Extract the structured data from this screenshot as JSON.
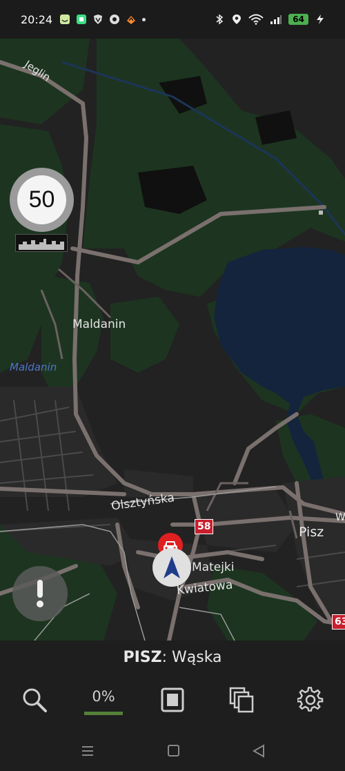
{
  "status_bar": {
    "time": "20:24",
    "battery": "64",
    "icons_left": [
      "face-app-icon",
      "android-app-icon",
      "vpn-shield-icon",
      "chrome-icon",
      "map-app-icon",
      "more-dot-icon"
    ],
    "icons_right": [
      "bluetooth-icon",
      "location-icon",
      "wifi-icon",
      "signal-icon",
      "battery-icon",
      "charging-icon"
    ]
  },
  "map": {
    "labels": {
      "jeglin": "Jeglin",
      "maldanin_town": "Maldanin",
      "maldanin_water": "Maldanin",
      "olsztynska": "Olsztyńska",
      "pisz": "Pisz",
      "matejki": "Matejki",
      "kwiatowa": "Kwiatowa",
      "w_edge": "W"
    },
    "road_badges": {
      "r58": "58",
      "r63": "63"
    },
    "speed_limit": "50",
    "colors": {
      "background": "#222222",
      "forest": "#1d3520",
      "water": "#14243d",
      "road": "#7a706d"
    }
  },
  "bottom": {
    "city": "PISZ",
    "separator": ":",
    "street": " Wąska",
    "progress_label": "0%",
    "progress": 0
  },
  "icons": {
    "search": "search-icon",
    "progress": "progress-icon",
    "stop": "stop-icon",
    "layers": "layers-icon",
    "settings": "gear-icon"
  }
}
